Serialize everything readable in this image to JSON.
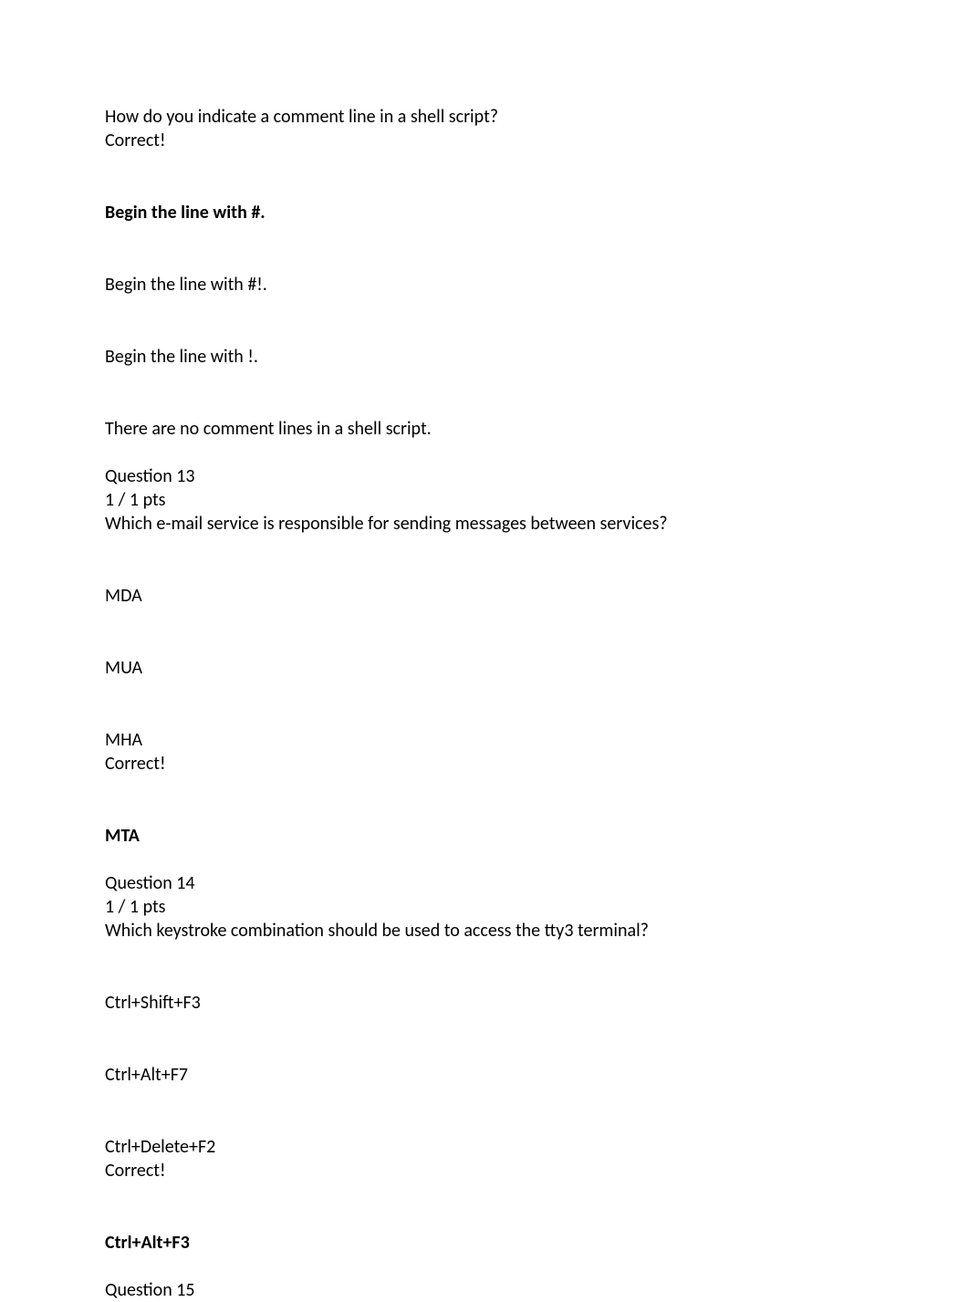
{
  "q12": {
    "prompt": "How do you indicate a comment line in a shell script?",
    "correct_label": "Correct!",
    "answer_correct": "Begin the line with #.",
    "answer_b": "Begin the line with #!.",
    "answer_c": "Begin the line with !.",
    "answer_d": "There are no comment lines in a shell script."
  },
  "q13": {
    "header": "Question 13",
    "pts": "1 / 1 pts",
    "prompt": "Which e-mail service is responsible for sending messages between services?",
    "answer_a": "MDA",
    "answer_b": "MUA",
    "answer_c": "MHA",
    "correct_label": "Correct!",
    "answer_correct": "MTA"
  },
  "q14": {
    "header": "Question 14",
    "pts": "1 / 1 pts",
    "prompt": "Which keystroke combination should be used to access the tty3 terminal?",
    "answer_a": "Ctrl+Shift+F3",
    "answer_b": "Ctrl+Alt+F7",
    "answer_c": "Ctrl+Delete+F2",
    "correct_label": "Correct!",
    "answer_correct": "Ctrl+Alt+F3"
  },
  "q15": {
    "header": "Question 15"
  }
}
